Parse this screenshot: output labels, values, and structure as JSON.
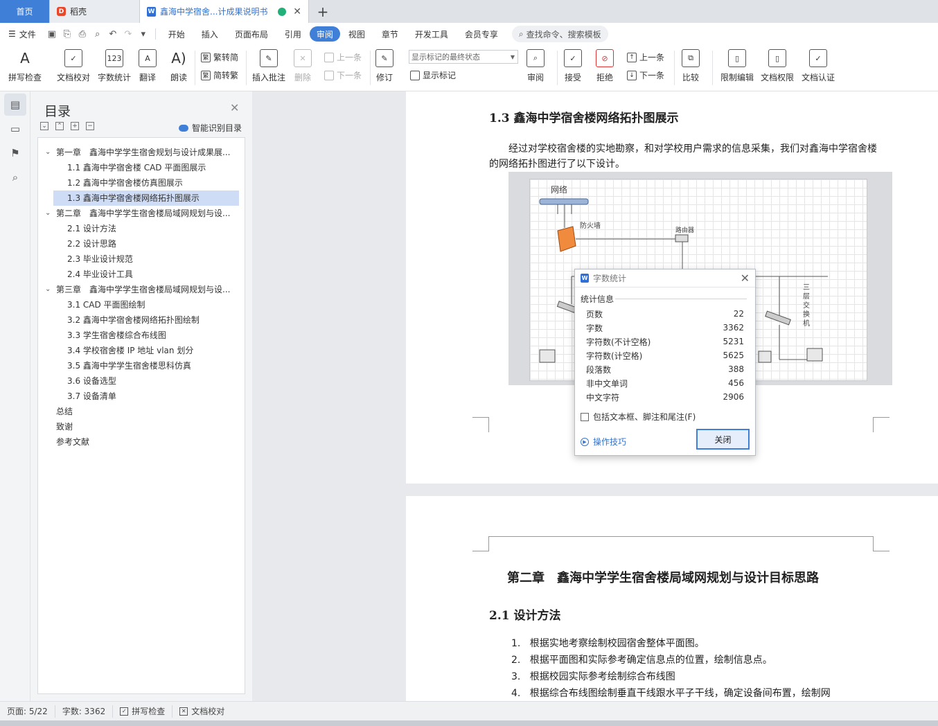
{
  "tabs": {
    "home": "首页",
    "daoke": "稻壳",
    "doc": "鑫海中学宿舍...计成果说明书",
    "new": "+"
  },
  "menu": {
    "file": "文件",
    "items": [
      "开始",
      "插入",
      "页面布局",
      "引用",
      "审阅",
      "视图",
      "章节",
      "开发工具",
      "会员专享"
    ],
    "active": "审阅",
    "search": "查找命令、搜索模板"
  },
  "ribbon": {
    "spell": "拼写检查",
    "proof": "文档校对",
    "count": "字数统计",
    "translate": "翻译",
    "read": "朗读",
    "trad": "繁转简",
    "simp": "简转繁",
    "comment": "插入批注",
    "delete": "删除",
    "prev_comment": "上一条",
    "next_comment": "下一条",
    "revise": "修订",
    "markup_combo": "显示标记的最终状态",
    "show_markup": "显示标记",
    "review": "审阅",
    "accept": "接受",
    "reject": "拒绝",
    "prev": "上一条",
    "next": "下一条",
    "compare": "比较",
    "restrict": "限制编辑",
    "rights": "文档权限",
    "certify": "文档认证"
  },
  "toc": {
    "title": "目录",
    "smart": "智能识别目录",
    "items": [
      {
        "text": "第一章　鑫海中学学生宿舍规划与设计成果展...",
        "level": 1
      },
      {
        "text": "1.1  鑫海中学宿舍楼 CAD 平面图展示",
        "level": 2
      },
      {
        "text": "1.2  鑫海中学宿舍楼仿真图展示",
        "level": 2
      },
      {
        "text": "1.3 鑫海中学宿舍楼网络拓扑图展示",
        "level": 2
      },
      {
        "text": "第二章　鑫海中学学生宿舍楼局域网规划与设...",
        "level": 1
      },
      {
        "text": "2.1 设计方法",
        "level": 2
      },
      {
        "text": "2.2  设计思路",
        "level": 2
      },
      {
        "text": "2.3  毕业设计规范",
        "level": 2
      },
      {
        "text": "2.4 毕业设计工具",
        "level": 2
      },
      {
        "text": "第三章　鑫海中学学生宿舍楼局域网规划与设...",
        "level": 1
      },
      {
        "text": "3.1 CAD 平面图绘制",
        "level": 2
      },
      {
        "text": "3.2  鑫海中学宿舍楼网络拓扑图绘制",
        "level": 2
      },
      {
        "text": "3.3  学生宿舍楼综合布线图",
        "level": 2
      },
      {
        "text": "3.4  学校宿舍楼 IP 地址 vlan 划分",
        "level": 2
      },
      {
        "text": "3.5  鑫海中学学生宿舍楼思科仿真",
        "level": 2
      },
      {
        "text": "3.6 设备选型",
        "level": 2
      },
      {
        "text": "3.7  设备清单",
        "level": 2
      },
      {
        "text": "总结",
        "level": 0
      },
      {
        "text": "致谢",
        "level": 0
      },
      {
        "text": "参考文献",
        "level": 0
      }
    ],
    "selected_index": 3
  },
  "page1": {
    "heading": "1.3 鑫海中学宿舍楼网络拓扑图展示",
    "para_line1": "经过对学校宿舍楼的实地勘察，和对学校用户需求的信息采集，我们对鑫海中学宿舍楼",
    "para_line2": "的网络拓扑图进行了以下设计。",
    "fig_network": "网络",
    "fig_firewall": "防火墙",
    "fig_router": "路由器",
    "fig_switch3": "三层交换机"
  },
  "page2": {
    "chapter": "第二章　鑫海中学学生宿舍楼局域网规划与设计目标思路",
    "section": "2.1 设计方法",
    "list": [
      "根据实地考察绘制校园宿舍整体平面图。",
      "根据平面图和实际参考确定信息点的位置，绘制信息点。",
      "根据校园实际参考绘制综合布线图",
      "根据综合布线图绘制垂直干线跟水平子干线，确定设备间布置，绘制网"
    ]
  },
  "dialog": {
    "title": "字数统计",
    "group": "统计信息",
    "rows": [
      {
        "label": "页数",
        "value": "22"
      },
      {
        "label": "字数",
        "value": "3362"
      },
      {
        "label": "字符数(不计空格)",
        "value": "5231"
      },
      {
        "label": "字符数(计空格)",
        "value": "5625"
      },
      {
        "label": "段落数",
        "value": "388"
      },
      {
        "label": "非中文单词",
        "value": "456"
      },
      {
        "label": "中文字符",
        "value": "2906"
      }
    ],
    "checkbox": "包括文本框、脚注和尾注(F)",
    "tips": "操作技巧",
    "close": "关闭"
  },
  "status": {
    "page": "页面: 5/22",
    "words": "字数: 3362",
    "spell": "拼写检查",
    "proof": "文档校对"
  }
}
